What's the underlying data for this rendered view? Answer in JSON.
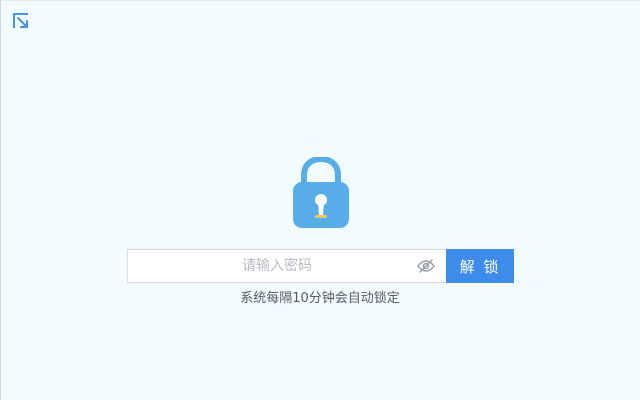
{
  "top_left_icon": "window-restore-icon",
  "lock": {
    "icon": "lock-icon",
    "colors": {
      "body": "#56ade8",
      "keyhole": "#ffffff",
      "keyhole_accent": "#f5c85b"
    }
  },
  "unlock_form": {
    "password": {
      "value": "",
      "placeholder": "请输入密码",
      "toggle_icon": "eye-off-icon"
    },
    "submit_label": "解 锁"
  },
  "hint": "系统每隔10分钟会自动锁定",
  "colors": {
    "background": "#f2fcff",
    "accent": "#3d8bea",
    "input_border": "#d9dde2",
    "hint_text": "#555b63"
  }
}
